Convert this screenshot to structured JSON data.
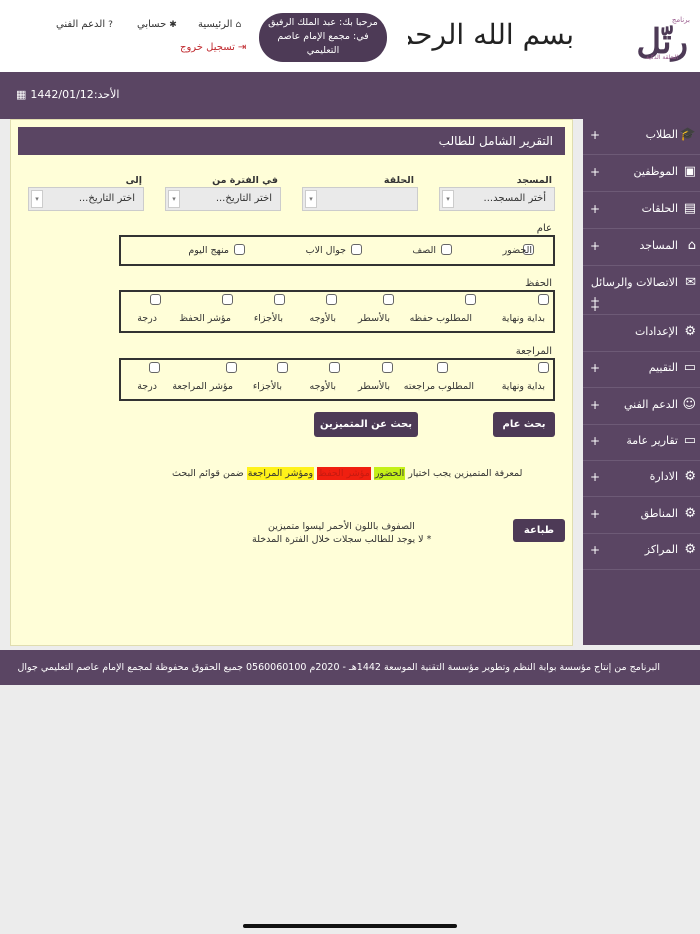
{
  "header": {
    "logo_text": "رتّل",
    "logo_top": "برنامج",
    "logo_sub": "الحلقة الذكية",
    "basmala": "بسم الله الرحمن الرحيم",
    "welcome": "مرحبا بك: عبد الملك الرفيق في: مجمع الإمام عاصم التعليمي",
    "nav": {
      "home": "الرئيسية",
      "account": "حسابي",
      "support": "الدعم الفني",
      "logout": "تسجيل خروج"
    }
  },
  "datebar": {
    "date": "الأحد:1442/01/12"
  },
  "sidebar": {
    "items": [
      {
        "label": "الطلاب",
        "icon": "student-icon"
      },
      {
        "label": "الموظفين",
        "icon": "id-card-icon"
      },
      {
        "label": "الحلقات",
        "icon": "board-icon"
      },
      {
        "label": "المساجد",
        "icon": "mosque-icon"
      },
      {
        "label": "الاتصالات والرسائل",
        "icon": "mail-icon"
      },
      {
        "label": "الإعدادات",
        "icon": "gear-icon"
      },
      {
        "label": "التقييم",
        "icon": "monitor-icon"
      },
      {
        "label": "الدعم الفني",
        "icon": "support-icon"
      },
      {
        "label": "تقارير عامة",
        "icon": "monitor-icon"
      },
      {
        "label": "الادارة",
        "icon": "gear-icon"
      },
      {
        "label": "المناطق",
        "icon": "gears-icon"
      },
      {
        "label": "المراكز",
        "icon": "gears-icon"
      }
    ],
    "plus": "+"
  },
  "main": {
    "title": "التقرير الشامل للطالب",
    "filters": {
      "mosque_label": "المسجد",
      "mosque_value": "أختر المسجد...",
      "halaqa_label": "الحلقة",
      "halaqa_value": "",
      "from_label": "في الفترة من",
      "from_value": "اختر التاريخ...",
      "to_label": "إلى",
      "to_value": "اختر التاريخ..."
    },
    "general": {
      "label": "عام",
      "options": [
        "الحضور",
        "الصف",
        "جوال الاب",
        "منهج اليوم"
      ]
    },
    "memorization": {
      "label": "الحفظ",
      "options": [
        "بداية ونهاية",
        "المطلوب حفظه",
        "بالأسطر",
        "بالأوجه",
        "بالأجزاء",
        "مؤشر الحفظ",
        "درجة"
      ]
    },
    "review": {
      "label": "المراجعة",
      "options": [
        "بداية ونهاية",
        "المطلوب مراجعته",
        "بالأسطر",
        "بالأوجه",
        "بالأجزاء",
        "مؤشر المراجعة",
        "درجة"
      ]
    },
    "buttons": {
      "general_search": "بحث عام",
      "distinguished_search": "بحث عن المتميزين",
      "print": "طباعة"
    },
    "note": {
      "prefix": "لمعرفة المتميزين يجب اختيار",
      "hl1": "الحضور",
      "hl2": "مؤشر الحفظ",
      "hl3": "ومؤشر المراجعة",
      "suffix": "ضمن قوائم البحث"
    },
    "red_rows": "الصفوف باللون الأحمر ليسوا متميزين",
    "no_records": "* لا يوجد للطالب سجلات خلال الفترة المدخلة"
  },
  "footer": {
    "text": "البرنامج من إنتاج مؤسسة بوابة النظم وتطوير مؤسسة التقنية الموسعة 1442هـ - 2020م 0560060100 جميع الحقوق محفوظة لمجمع الإمام عاصم التعليمي جوال"
  },
  "colors": {
    "primary": "#5a4563",
    "panel_bg": "#fffed8",
    "highlight_green": "#c4f018",
    "highlight_red": "#f01f10",
    "highlight_yellow": "#fff21a",
    "logout_red": "#c0282d"
  }
}
